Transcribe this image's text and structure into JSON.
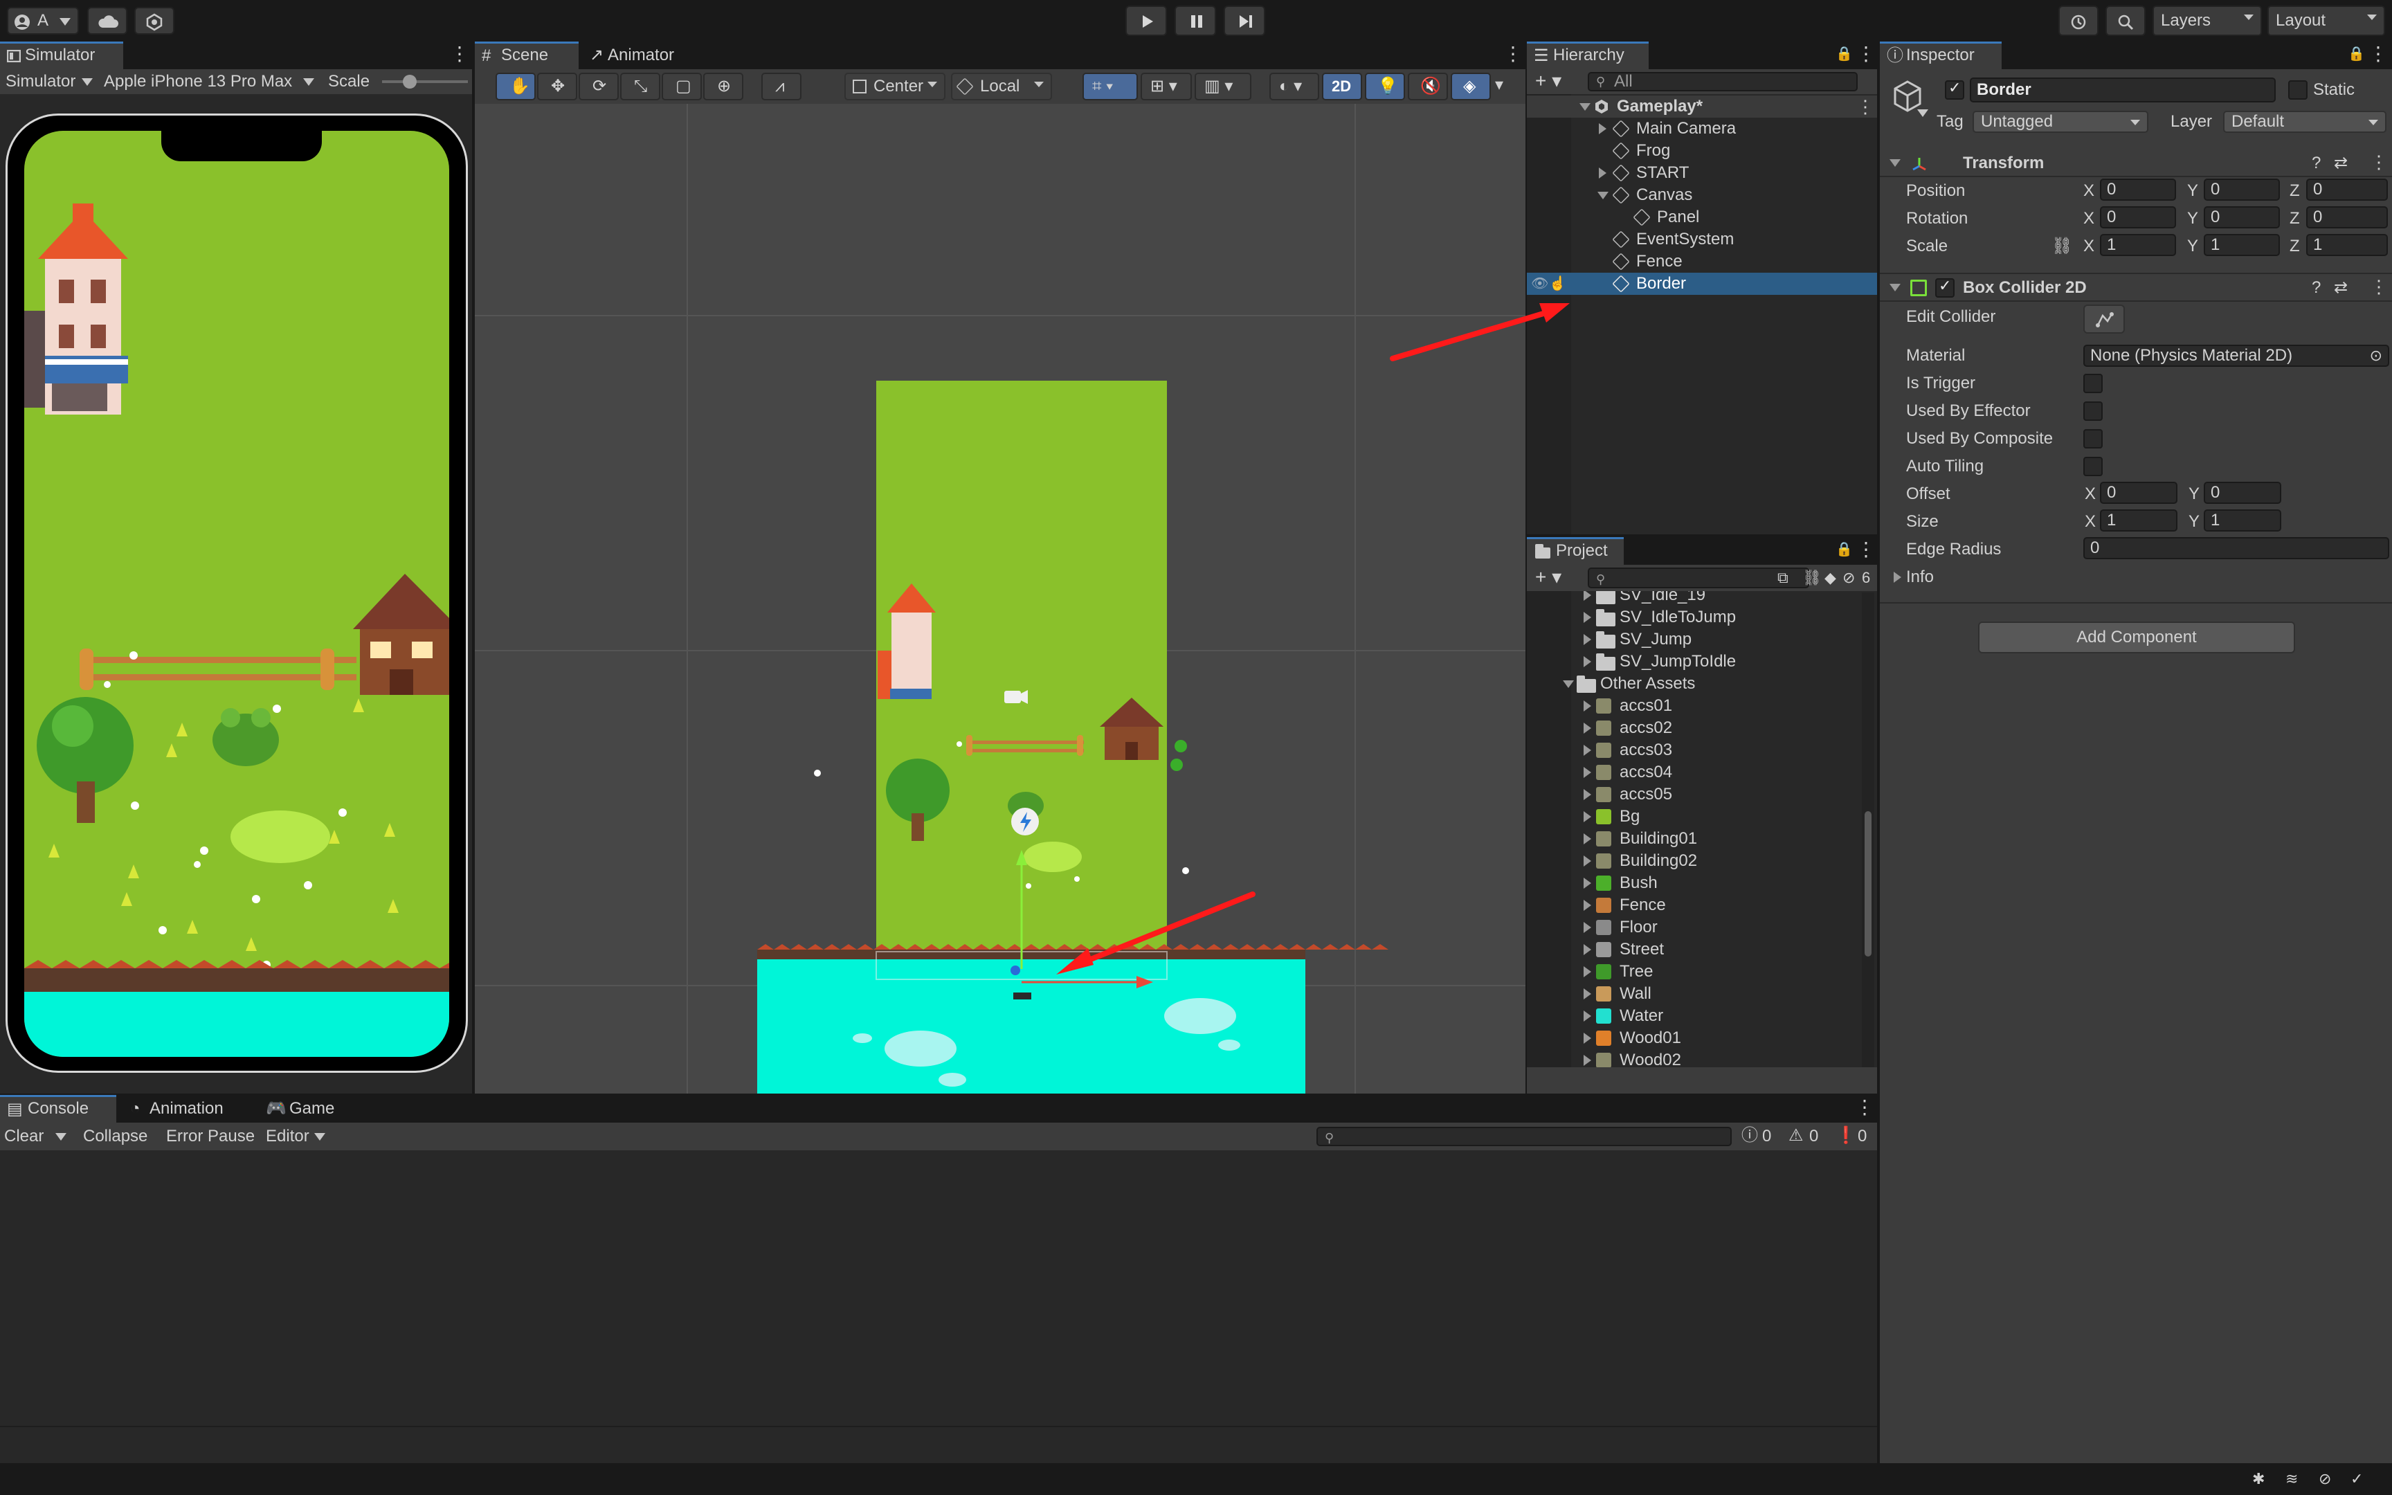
{
  "toolbar": {
    "account_label": "A",
    "play_icon": "play-icon",
    "pause_icon": "pause-icon",
    "step_icon": "step-icon",
    "layers_label": "Layers",
    "layout_label": "Layout"
  },
  "simulator": {
    "tab_label": "Simulator",
    "mode_label": "Simulator",
    "device_label": "Apple iPhone 13 Pro Max",
    "scale_label": "Scale"
  },
  "scene": {
    "tabs": [
      "Scene",
      "Animator"
    ],
    "pivot_label": "Center",
    "space_label": "Local",
    "mode_2d_label": "2D"
  },
  "hierarchy": {
    "tab_label": "Hierarchy",
    "search_placeholder": "All",
    "root": "Gameplay*",
    "items": [
      "Main Camera",
      "Frog",
      "START",
      "Canvas",
      "Panel",
      "EventSystem",
      "Fence",
      "Border"
    ],
    "selected": "Border"
  },
  "project": {
    "tab_label": "Project",
    "hidden_count": "6",
    "items": [
      {
        "name": "SV_Idle_19"
      },
      {
        "name": "SV_IdleToJump"
      },
      {
        "name": "SV_Jump"
      },
      {
        "name": "SV_JumpToIdle"
      },
      {
        "name": "Other Assets"
      },
      {
        "name": "accs01"
      },
      {
        "name": "accs02"
      },
      {
        "name": "accs03"
      },
      {
        "name": "accs04"
      },
      {
        "name": "accs05"
      },
      {
        "name": "Bg",
        "color": "#8ac12b"
      },
      {
        "name": "Building01"
      },
      {
        "name": "Building02"
      },
      {
        "name": "Bush",
        "color": "#4caf2a"
      },
      {
        "name": "Fence",
        "color": "#c47a3a"
      },
      {
        "name": "Floor",
        "color": "#8a8a8a"
      },
      {
        "name": "Street",
        "color": "#9a9a9a"
      },
      {
        "name": "Tree",
        "color": "#3f9a2a"
      },
      {
        "name": "Wall",
        "color": "#c99a5a"
      },
      {
        "name": "Water",
        "color": "#22e0d0"
      },
      {
        "name": "Wood01",
        "color": "#e0802a"
      },
      {
        "name": "Wood02"
      }
    ]
  },
  "inspector": {
    "tab_label": "Inspector",
    "object_name": "Border",
    "static_label": "Static",
    "tag_label": "Tag",
    "tag_value": "Untagged",
    "layer_label": "Layer",
    "layer_value": "Default",
    "transform": {
      "title": "Transform",
      "rows": [
        {
          "label": "Position",
          "x": "0",
          "y": "0",
          "z": "0"
        },
        {
          "label": "Rotation",
          "x": "0",
          "y": "0",
          "z": "0"
        },
        {
          "label": "Scale",
          "x": "1",
          "y": "1",
          "z": "1"
        }
      ]
    },
    "box_collider": {
      "title": "Box Collider 2D",
      "edit_collider_label": "Edit Collider",
      "material_label": "Material",
      "material_value": "None (Physics Material 2D)",
      "is_trigger_label": "Is Trigger",
      "used_by_effector_label": "Used By Effector",
      "used_by_composite_label": "Used By Composite",
      "auto_tiling_label": "Auto Tiling",
      "offset_label": "Offset",
      "offset": {
        "x": "0",
        "y": "0"
      },
      "size_label": "Size",
      "size": {
        "x": "1",
        "y": "1"
      },
      "edge_radius_label": "Edge Radius",
      "edge_radius_value": "0",
      "info_label": "Info"
    },
    "add_component_label": "Add Component",
    "axis_x": "X",
    "axis_y": "Y",
    "axis_z": "Z"
  },
  "console": {
    "tabs": [
      "Console",
      "Animation",
      "Game"
    ],
    "clear_label": "Clear",
    "collapse_label": "Collapse",
    "error_pause_label": "Error Pause",
    "editor_label": "Editor",
    "log_count": "0",
    "warning_count": "0",
    "error_count": "0"
  },
  "colors": {
    "accent": "#2c5d87",
    "grass": "#8ac12b",
    "water": "#00f5d8",
    "annotation_arrow": "#ff1a1a"
  }
}
